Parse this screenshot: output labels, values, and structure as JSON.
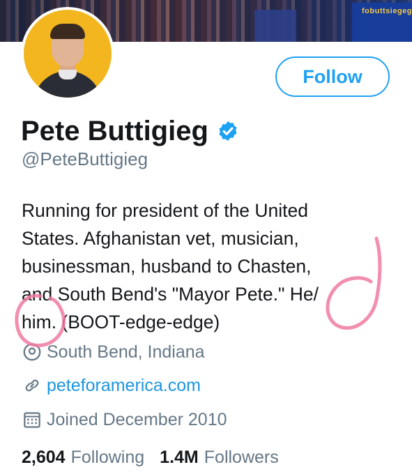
{
  "banner": {
    "sign_text": "fobuttsiegeg"
  },
  "profile": {
    "follow_label": "Follow",
    "display_name": "Pete Buttigieg",
    "handle": "@PeteButtigieg",
    "verified": true,
    "bio_lines": [
      "Running for president of the United",
      "States. Afghanistan vet, musician,",
      "businessman, husband to Chasten,",
      "and South Bend's \"Mayor Pete.\" He/",
      "him. (BOOT-edge-edge)"
    ],
    "location": "South Bend, Indiana",
    "website": "peteforamerica.com",
    "joined": "Joined December 2010",
    "following_count": "2,604",
    "following_label": "Following",
    "followers_count": "1.4M",
    "followers_label": "Followers"
  },
  "icons": {
    "verified": "verified-badge-icon",
    "location": "location-pin-icon",
    "website": "link-icon",
    "joined": "calendar-icon"
  },
  "colors": {
    "accent": "#1da1f2",
    "link": "#1b95e0",
    "secondary_text": "#657786",
    "primary_text": "#14171a",
    "annotation": "#f07aa0",
    "avatar_bg": "#f3b61f"
  }
}
